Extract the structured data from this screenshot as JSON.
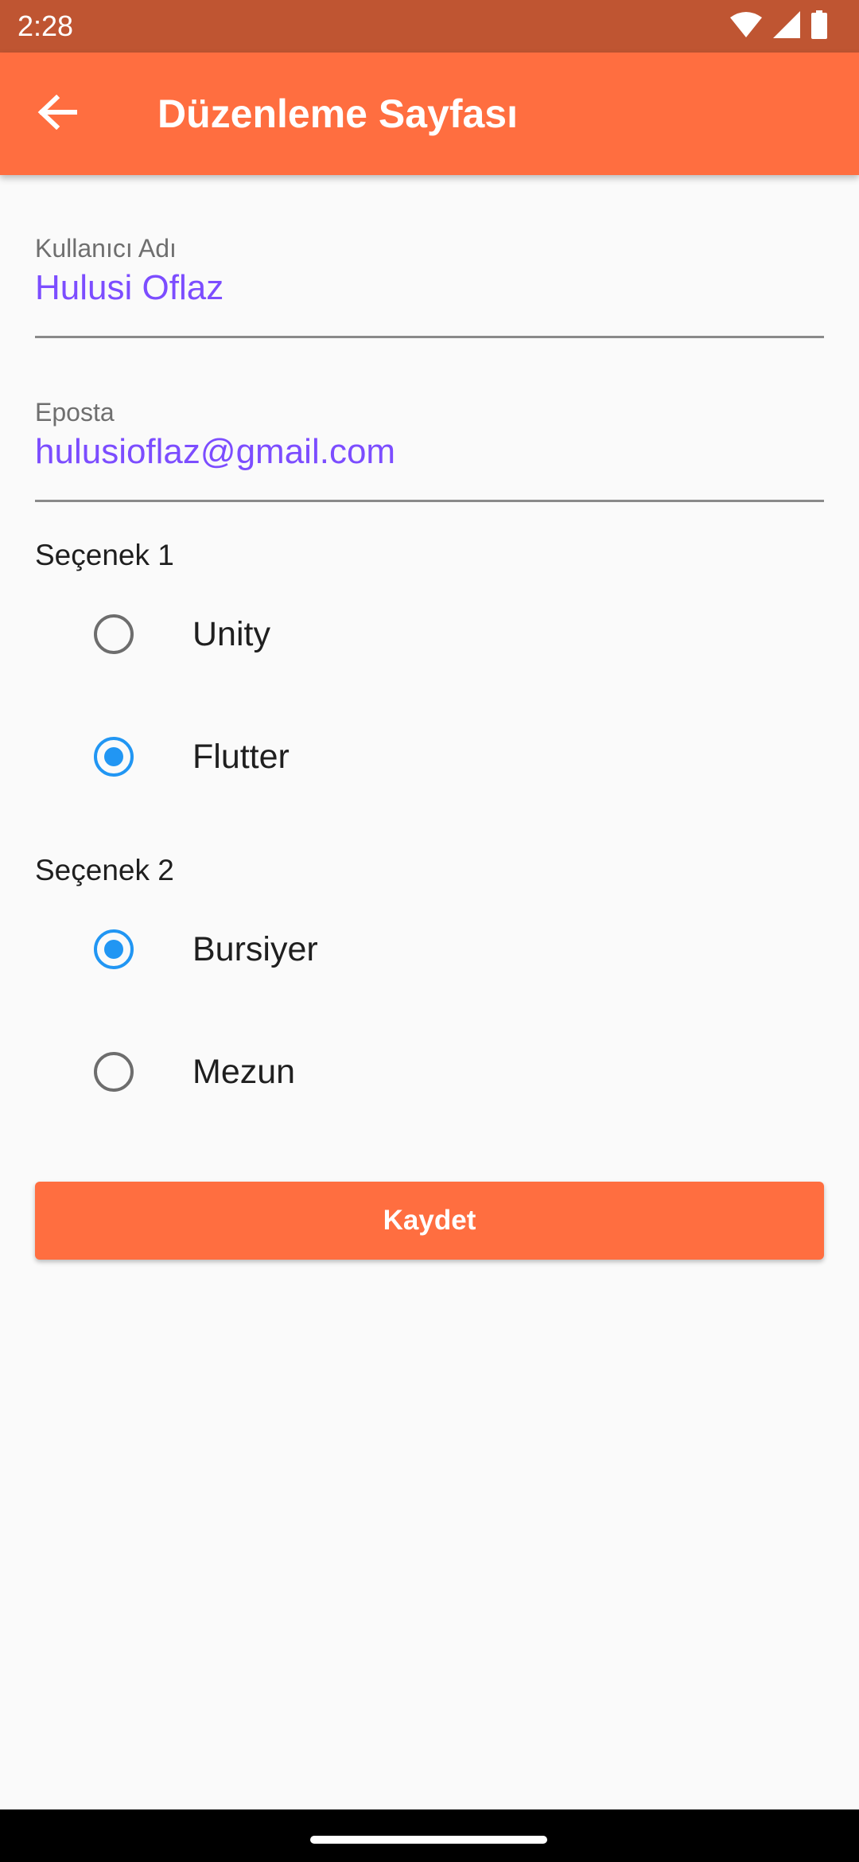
{
  "status_bar": {
    "time": "2:28",
    "icons": [
      "wifi-icon",
      "signal-icon",
      "battery-icon"
    ]
  },
  "app_bar": {
    "title": "Düzenleme Sayfası",
    "back_icon": "arrow-back-icon",
    "color": "#ff6e40"
  },
  "form": {
    "username": {
      "label": "Kullanıcı Adı",
      "value": "Hulusi Oflaz"
    },
    "email": {
      "label": "Eposta",
      "value": "hulusioflaz@gmail.com"
    },
    "option_group_1": {
      "title": "Seçenek 1",
      "options": [
        {
          "label": "Unity",
          "selected": false
        },
        {
          "label": "Flutter",
          "selected": true
        }
      ]
    },
    "option_group_2": {
      "title": "Seçenek 2",
      "options": [
        {
          "label": "Bursiyer",
          "selected": true
        },
        {
          "label": "Mezun",
          "selected": false
        }
      ]
    },
    "save_label": "Kaydet"
  },
  "colors": {
    "accent": "#ff6e40",
    "status_bar": "#bf5532",
    "input_text": "#7c4dff",
    "radio_selected": "#2196f3"
  }
}
